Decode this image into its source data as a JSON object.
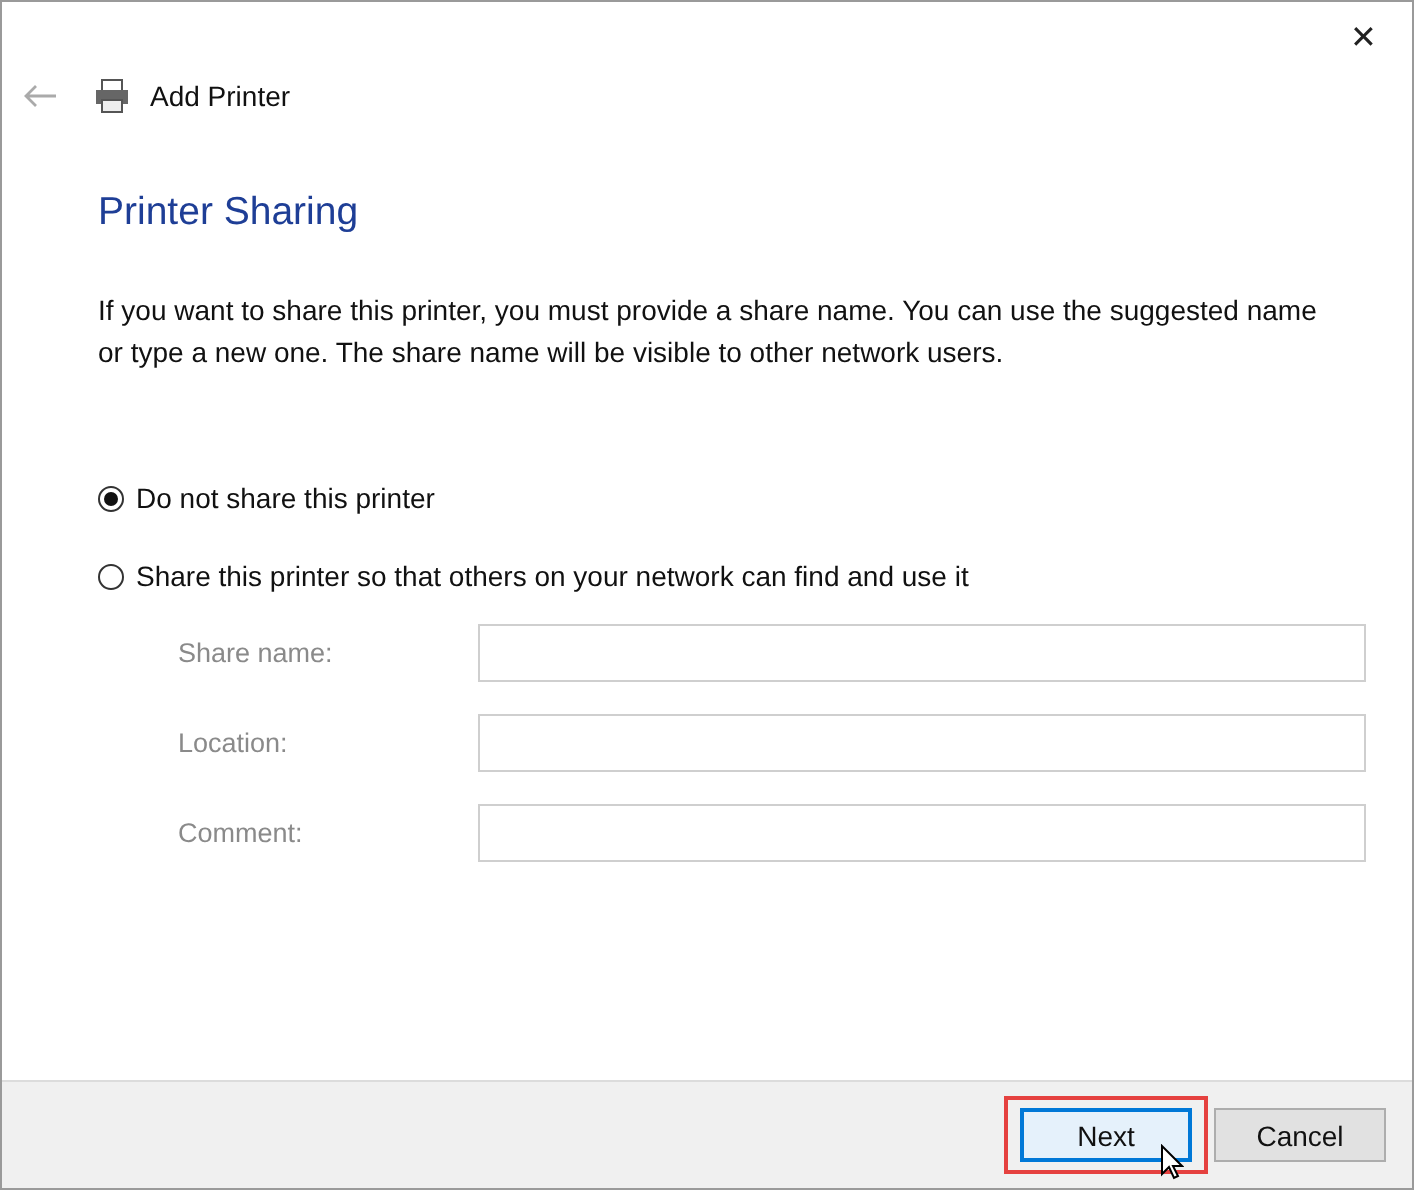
{
  "window": {
    "title": "Add Printer",
    "close_glyph": "✕"
  },
  "heading": "Printer Sharing",
  "description": "If you want to share this printer, you must provide a share name. You can use the suggested name or type a new one. The share name will be visible to other network users.",
  "options": [
    {
      "label": "Do not share this printer",
      "selected": true
    },
    {
      "label": "Share this printer so that others on your network can find and use it",
      "selected": false
    }
  ],
  "fields": [
    {
      "label": "Share name:",
      "disabled": true
    },
    {
      "label": "Location:",
      "disabled": true
    },
    {
      "label": "Comment:",
      "disabled": true
    }
  ],
  "buttons": [
    {
      "label": "Next",
      "highlighted": true
    },
    {
      "label": "Cancel",
      "highlighted": false
    }
  ]
}
